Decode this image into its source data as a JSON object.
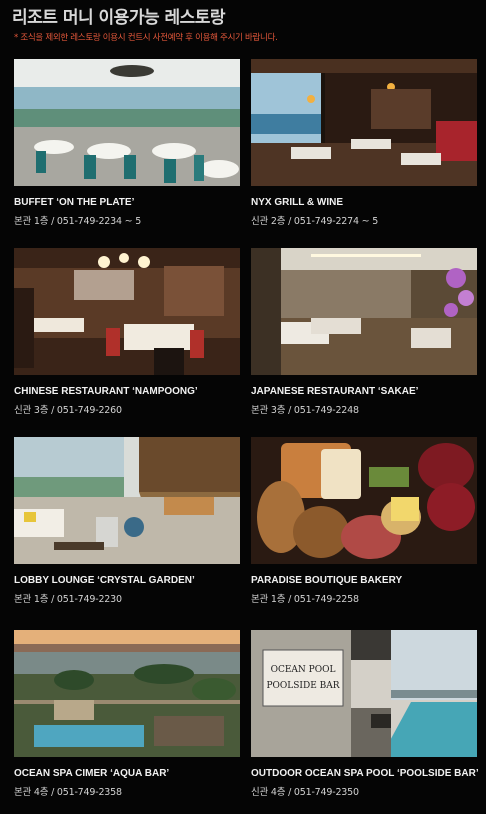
{
  "header": {
    "title": "리조트 머니 이용가능 레스토랑",
    "notice": "* 조식을 제외한 레스토랑 이용시 컨트시 사전예약 후 이용해 주시기 바랍니다."
  },
  "restaurants": [
    {
      "name": "BUFFET ‘ON THE PLATE’",
      "info": "본관 1층 / 051-749-2234 ~ 5",
      "photo": "buffet-dining-room-photo"
    },
    {
      "name": "NYX GRILL & WINE",
      "info": "신관 2층 / 051-749-2274 ~ 5",
      "photo": "grill-ocean-view-photo"
    },
    {
      "name": "CHINESE RESTAURANT ‘NAMPOONG’",
      "info": "신관 3층 / 051-749-2260",
      "photo": "chinese-restaurant-photo"
    },
    {
      "name": " JAPANESE RESTAURANT ‘SAKAE’",
      "info": "본관 3층 / 051-749-2248",
      "photo": "japanese-restaurant-photo"
    },
    {
      "name": "LOBBY LOUNGE ‘CRYSTAL GARDEN’",
      "info": "본관 1층 / 051-749-2230",
      "photo": "lobby-lounge-photo"
    },
    {
      "name": "PARADISE BOUTIQUE BAKERY",
      "info": "본관 1층 / 051-749-2258",
      "photo": "bakery-bread-photo"
    },
    {
      "name": "OCEAN SPA CIMER ‘AQUA BAR’",
      "info": "본관 4층 / 051-749-2358",
      "photo": "spa-aqua-bar-photo"
    },
    {
      "name": "OUTDOOR OCEAN SPA POOL ‘POOLSIDE BAR’",
      "info": "신관 4층 / 051-749-2350",
      "photo": "poolside-bar-photo",
      "sign_text": "OCEAN POOL POOLSIDE BAR"
    }
  ]
}
